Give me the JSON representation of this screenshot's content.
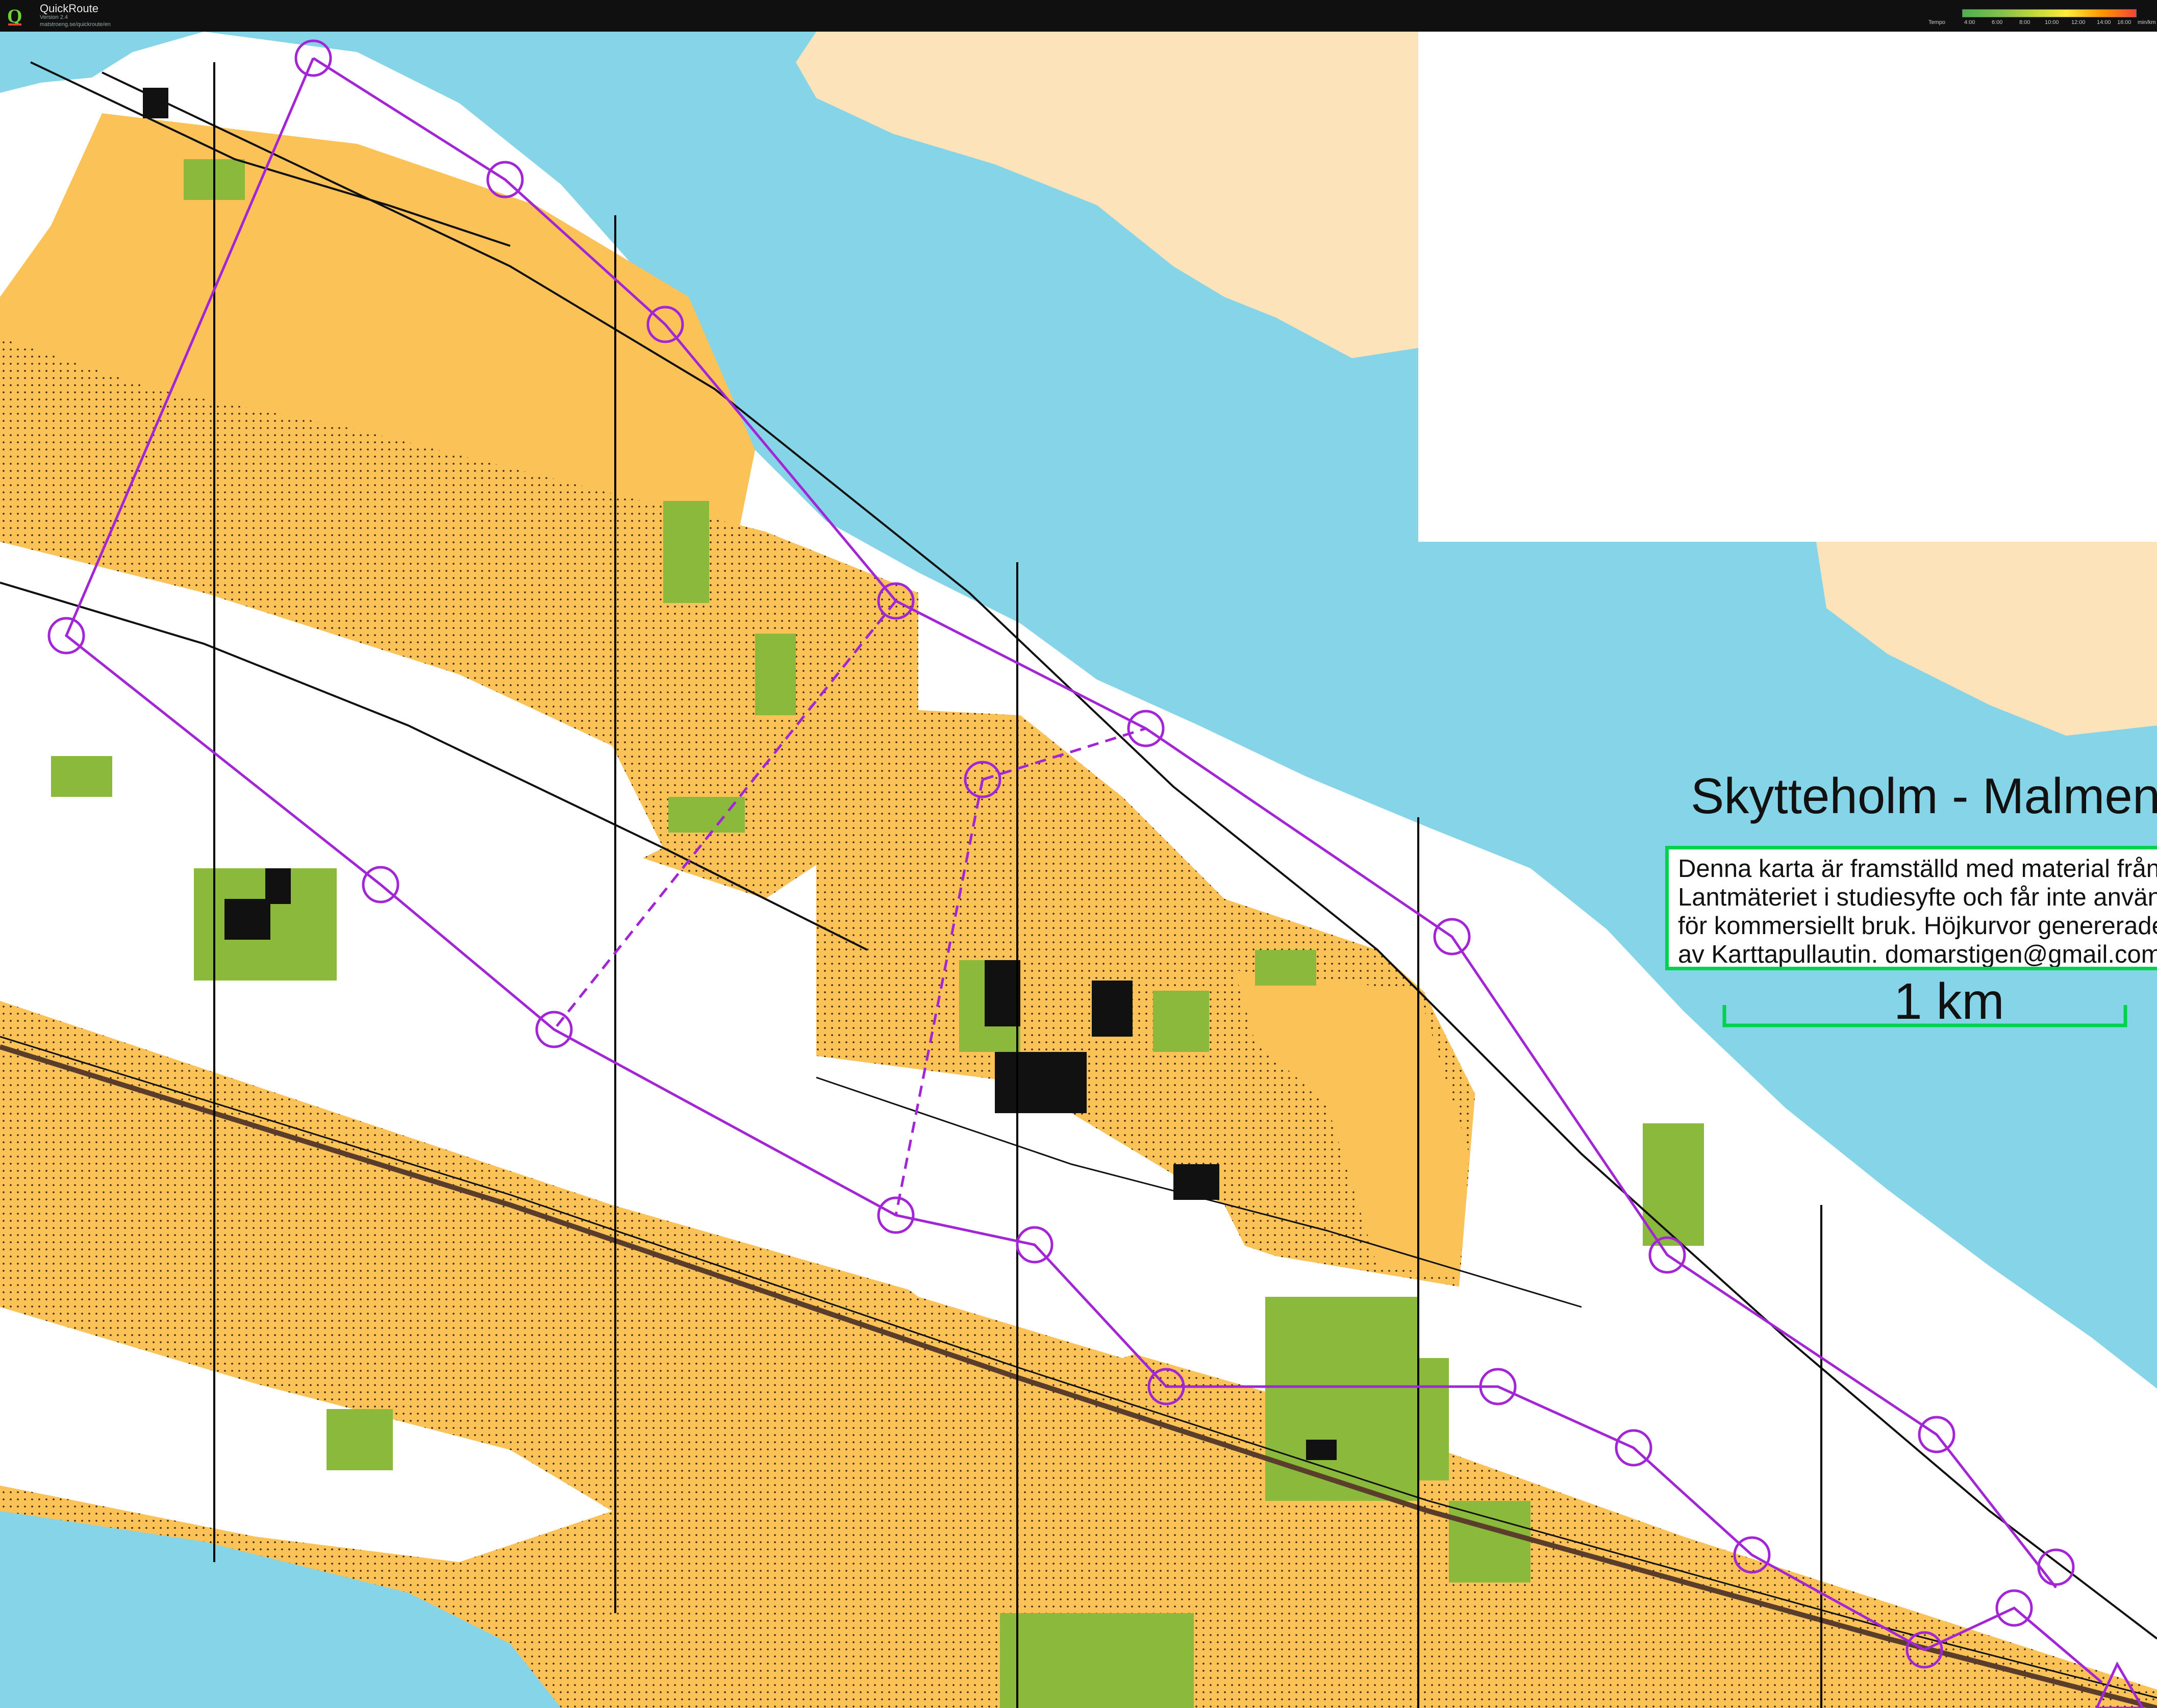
{
  "app": {
    "name": "QuickRoute",
    "version": "Version 2.4",
    "url": "matstroeng.se/quickroute/en",
    "logo_letter": "Q"
  },
  "tempo_legend": {
    "title": "Tempo",
    "ticks": [
      "4:00",
      "6:00",
      "8:00",
      "10:00",
      "12:00",
      "14:00",
      "16:00"
    ],
    "unit": "min/km"
  },
  "map": {
    "title": "Skytteholm - Malmen",
    "copyright_lines": [
      "Denna karta är framställd med material från",
      "Lantmäteriet i studiesyfte och får inte använ",
      "för kommersiellt bruk. Höjkurvor genererade",
      "av Karttapullautin. domarstigen@gmail.com"
    ],
    "scale_label": "1 km",
    "colors": {
      "water": "#86d4e8",
      "open_land": "#fbc258",
      "rough_open": "#fde3b9",
      "forest": "#ffffff",
      "green_vegetation": "#8ab93c",
      "course_overprint": "#a326d6",
      "copyright_border": "#00d24e"
    },
    "course_type": "orienteering course overlay",
    "control_count": 21
  }
}
